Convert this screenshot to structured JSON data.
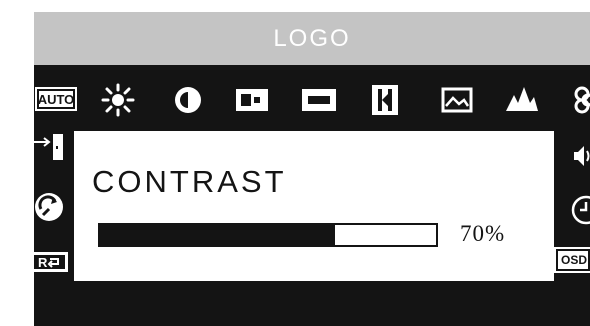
{
  "header": {
    "logo": "LOGO"
  },
  "menu": {
    "auto_label": "AUTO",
    "osd_label": "OSD",
    "icons": [
      "auto-adjust-icon",
      "brightness-icon",
      "contrast-icon",
      "position-icon",
      "size-icon",
      "phase-icon",
      "image-icon",
      "sharpness-icon",
      "color-icon",
      "exit-icon",
      "recall-icon",
      "reset-icon",
      "volume-icon",
      "timer-icon",
      "osd-icon"
    ]
  },
  "panel": {
    "title": "CONTRAST",
    "value_text": "70%",
    "value_fraction": 0.7
  },
  "colors": {
    "background": "#141414",
    "header": "#c4c4c4",
    "panel": "#ffffff",
    "foreground": "#141414"
  }
}
